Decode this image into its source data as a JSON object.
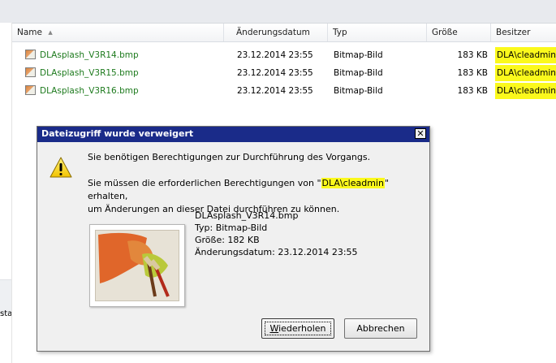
{
  "columns": {
    "name": "Name",
    "date": "Änderungsdatum",
    "type": "Typ",
    "size": "Größe",
    "owner": "Besitzer"
  },
  "files": [
    {
      "name": "DLAsplash_V3R14.bmp",
      "date": "23.12.2014 23:55",
      "type": "Bitmap-Bild",
      "size": "183 KB",
      "owner": "DLA\\cleadmin"
    },
    {
      "name": "DLAsplash_V3R15.bmp",
      "date": "23.12.2014 23:55",
      "type": "Bitmap-Bild",
      "size": "183 KB",
      "owner": "DLA\\cleadmin"
    },
    {
      "name": "DLAsplash_V3R16.bmp",
      "date": "23.12.2014 23:55",
      "type": "Bitmap-Bild",
      "size": "183 KB",
      "owner": "DLA\\cleadmin"
    }
  ],
  "nav": {
    "partial_label": "sta"
  },
  "dialog": {
    "title": "Dateizugriff wurde verweigert",
    "message1": "Sie benötigen Berechtigungen zur Durchführung des Vorgangs.",
    "message2_prefix": "Sie müssen die erforderlichen Berechtigungen von \"",
    "message2_user": "DLA\\cleadmin",
    "message2_suffix": "\" erhalten,",
    "message2_line2": "um Änderungen an dieser Datei durchführen zu können.",
    "file_name": "DLAsplash_V3R14.bmp",
    "file_type": "Typ: Bitmap-Bild",
    "file_size": "Größe: 182 KB",
    "file_date": "Änderungsdatum: 23.12.2014 23:55",
    "retry_mnemonic": "W",
    "retry_rest": "iederholen",
    "cancel_label": "Abbrechen",
    "close_glyph": "✕"
  },
  "colors": {
    "highlight": "#fbf91c",
    "titlebar": "#1a2b89",
    "filename_green": "#1d7a1d"
  },
  "icons": {
    "warning": "warning-icon",
    "bitmap": "bitmap-file-icon",
    "sort": "sort-ascending-icon",
    "close": "close-icon"
  }
}
